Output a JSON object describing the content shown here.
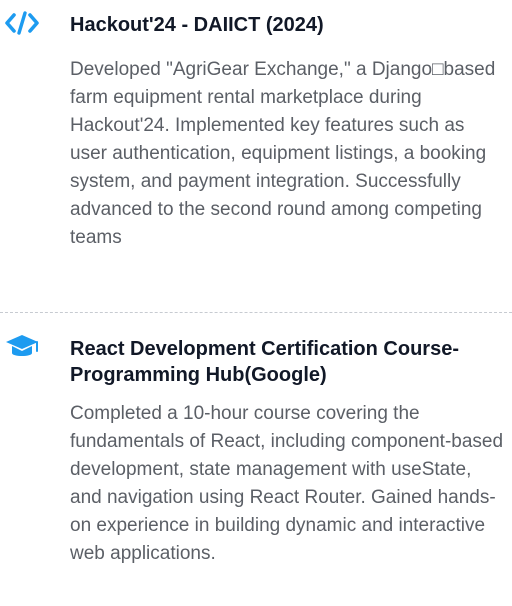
{
  "entries": [
    {
      "icon": "code-icon",
      "title": "Hackout'24 - DAIICT (2024)",
      "description": "Developed \"AgriGear Exchange,\" a Django□based farm equipment rental marketplace during Hackout'24. Implemented key features such as user authentication, equipment listings, a booking system, and payment integration. Successfully advanced to the second round among competing teams"
    },
    {
      "icon": "graduation-cap-icon",
      "title": "React Development Certification Course-Programming Hub(Google)",
      "description": "Completed a 10-hour course covering the fundamentals of React, including component-based development, state management with useState, and navigation using React Router. Gained hands-on experience in building dynamic and interactive web applications."
    }
  ],
  "colors": {
    "accent": "#1d9bf0",
    "title": "#111827",
    "text": "#5b5f66",
    "divider": "#c7cbd1"
  }
}
